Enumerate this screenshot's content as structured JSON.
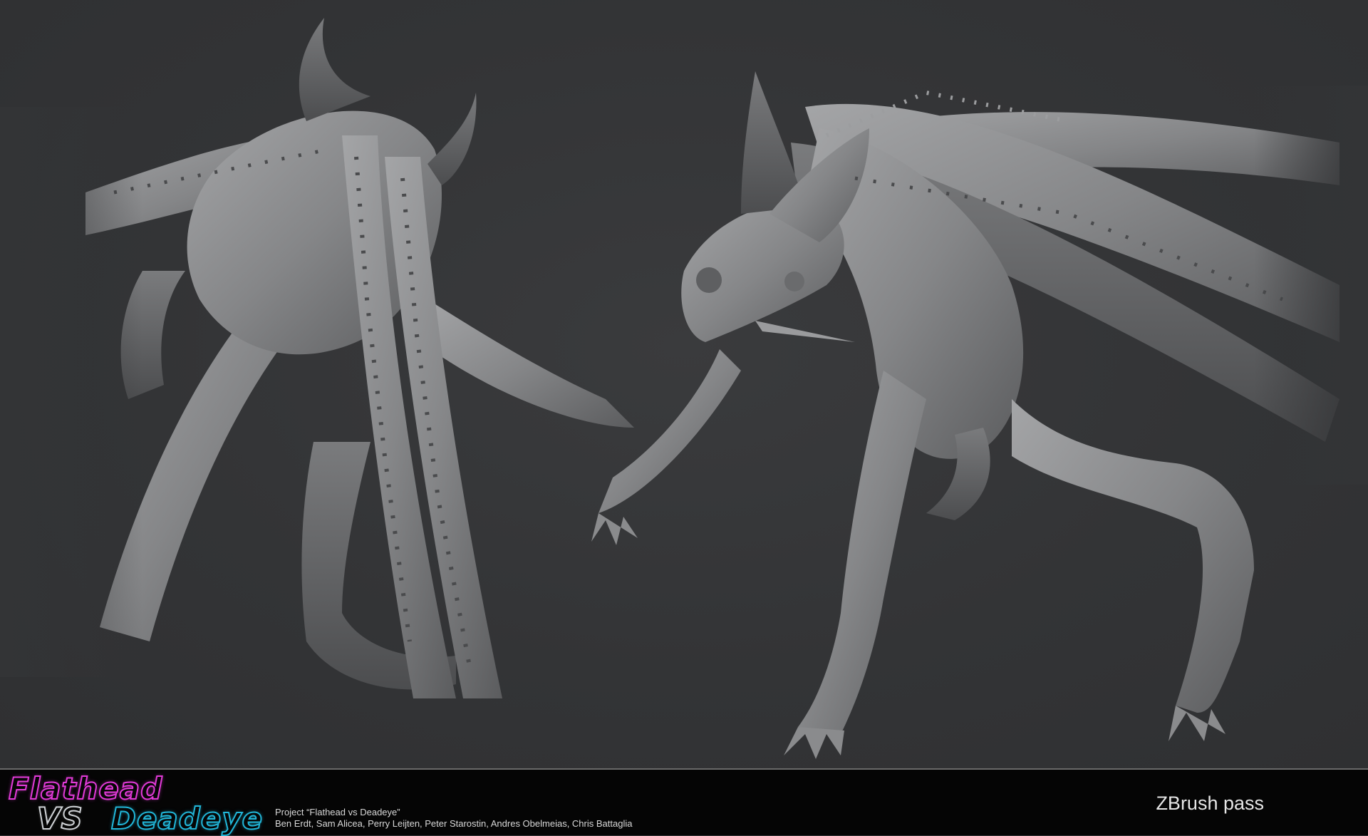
{
  "logo": {
    "word1": "Flathead",
    "word2": "VS",
    "word3": "Deadeye",
    "colors": {
      "flathead": "#e23ad8",
      "vs": "#cfd2d6",
      "deadeye": "#21b6d8"
    }
  },
  "credits": {
    "project_line": "Project “Flathead vs Deadeye”",
    "names_line": "Ben Erdt, Sam Alicea, Perry Leijten, Peter Starostin, Andres Obelmeias, Chris Battaglia"
  },
  "pass_label": "ZBrush pass",
  "colors": {
    "background": "#333436",
    "footer": "#050505",
    "sculpt_clay": "#8c8c8e"
  }
}
